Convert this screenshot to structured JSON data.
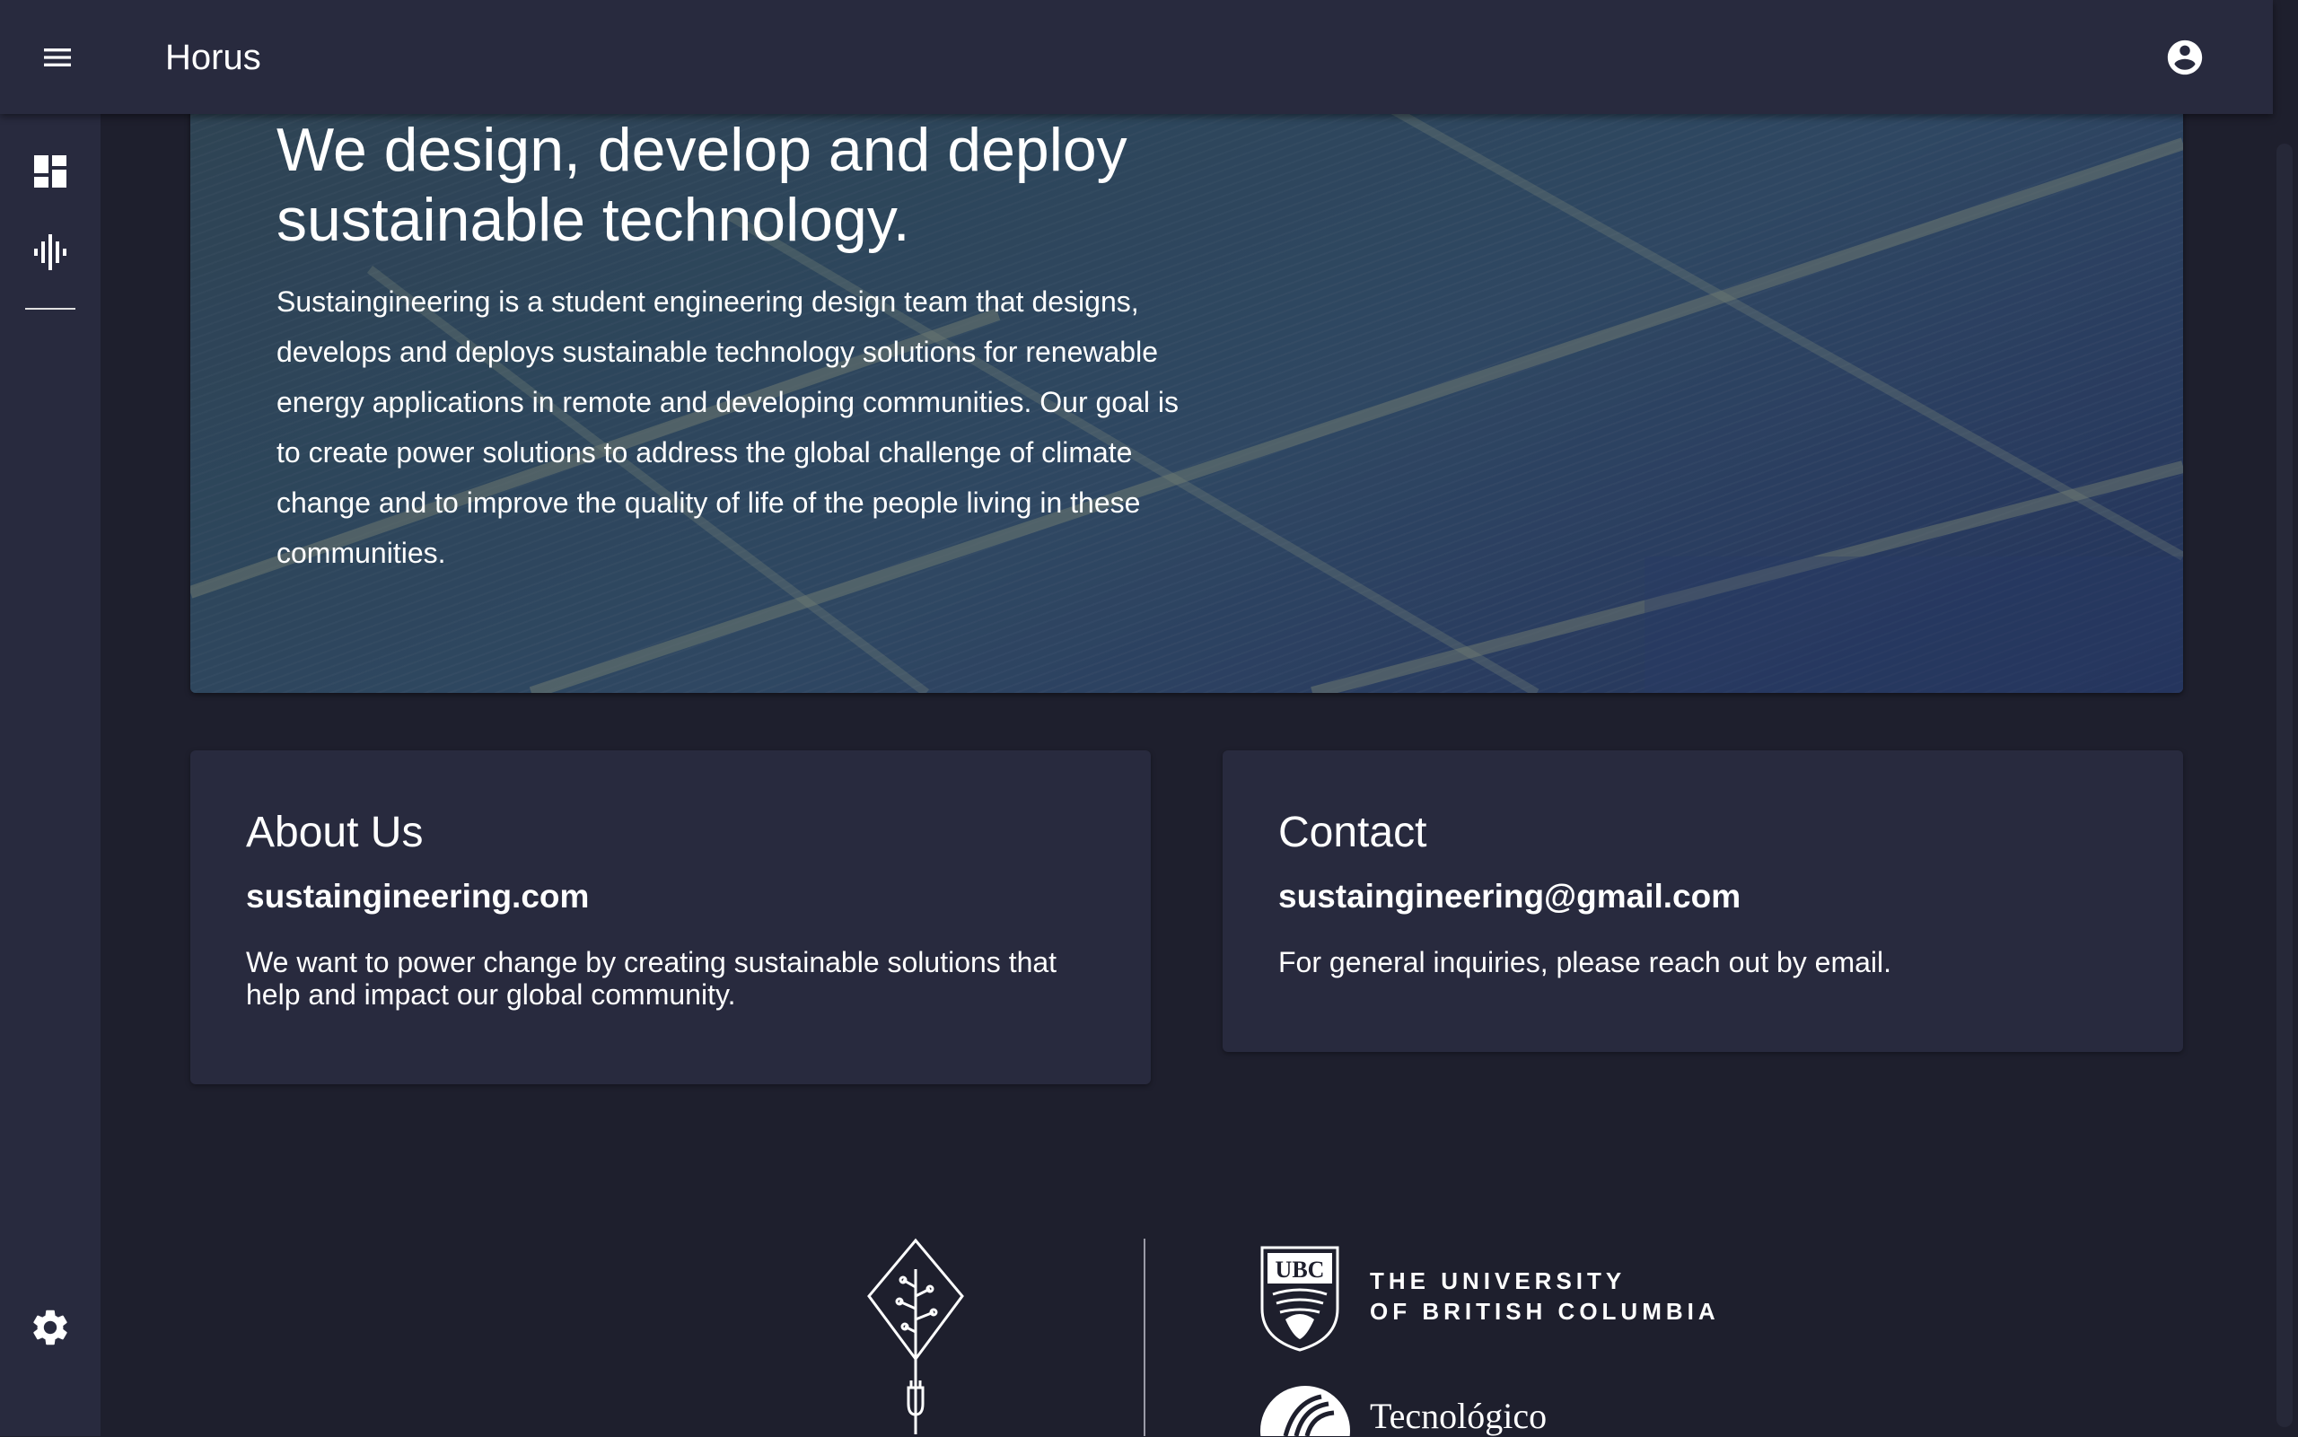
{
  "app": {
    "title": "Horus"
  },
  "icons": {
    "menu": "menu-icon",
    "account": "account-circle-icon",
    "dashboard": "dashboard-icon",
    "audio": "graphic-eq-icon",
    "settings": "gear-icon"
  },
  "hero": {
    "title": "We design, develop and deploy sustainable technology.",
    "text": "Sustaingineering is a student engineering design team that designs, develops and deploys sustainable technology solutions for renewable energy applications in remote and developing communities. Our goal is to create power solutions to address the global challenge of climate change and to improve the quality of life of the people living in these communities."
  },
  "cards": {
    "about": {
      "title": "About Us",
      "subtitle": "sustaingineering.com",
      "text": "We want to power change by creating sustainable solutions that help and impact our global community."
    },
    "contact": {
      "title": "Contact",
      "subtitle": "sustaingineering@gmail.com",
      "text": "For general inquiries, please reach out by email."
    }
  },
  "footer": {
    "ubc_line1": "THE UNIVERSITY",
    "ubc_line2": "OF BRITISH COLUMBIA",
    "ubc_crest_text": "UBC",
    "tec_name": "Tecnológico"
  },
  "colors": {
    "app_bar": "#282a3e",
    "background": "#1e1f2d",
    "card": "#282a3e",
    "text": "#ffffff"
  }
}
